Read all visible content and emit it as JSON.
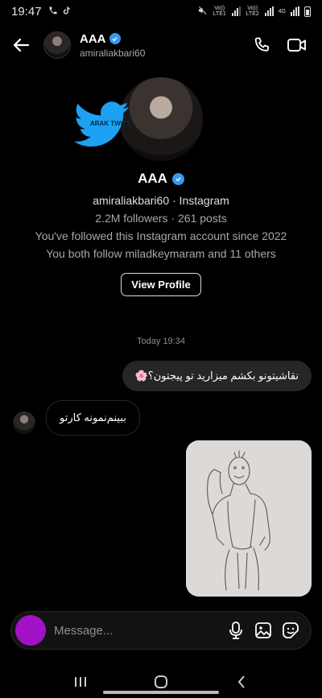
{
  "status_bar": {
    "time": "19:47",
    "left_icons": [
      "phone-icon",
      "tiktok-icon"
    ],
    "right_icons": [
      "mute-icon",
      "signal-lte1-icon",
      "signal-lte2-icon",
      "wifi-icon",
      "battery-icon"
    ],
    "sim1_label": "Vo)) LTE1",
    "sim2_label": "Vo)) LTE2",
    "data_label": "4G"
  },
  "header": {
    "title": "AAA",
    "username": "amiraliakbari60",
    "verified": true,
    "actions": [
      "phone-icon",
      "video-icon"
    ]
  },
  "profile": {
    "name": "AAA",
    "handle_line": "amiraliakbari60 · Instagram",
    "stats_line": "2.2M followers · 261 posts",
    "followed_line": "You've followed this Instagram account since 2022",
    "mutual_line": "You both follow miladkeymaram and 11 others",
    "view_profile_label": "View Profile",
    "watermark_text": "ARAK TWITTER"
  },
  "messages": {
    "timestamp": "Today 19:34",
    "outgoing_text": "نقاشیتونو بکشم میزارید تو پیجتون؟🌸",
    "incoming_text": "ببینم‌نمونه کارتو"
  },
  "composer": {
    "placeholder": "Message...",
    "icons": [
      "camera-icon",
      "microphone-icon",
      "gallery-icon",
      "sticker-icon"
    ]
  },
  "colors": {
    "background": "#000000",
    "bubble": "#262626",
    "camera": "#a112c6",
    "verified": "#3897f0",
    "twitter": "#1da1f2"
  }
}
